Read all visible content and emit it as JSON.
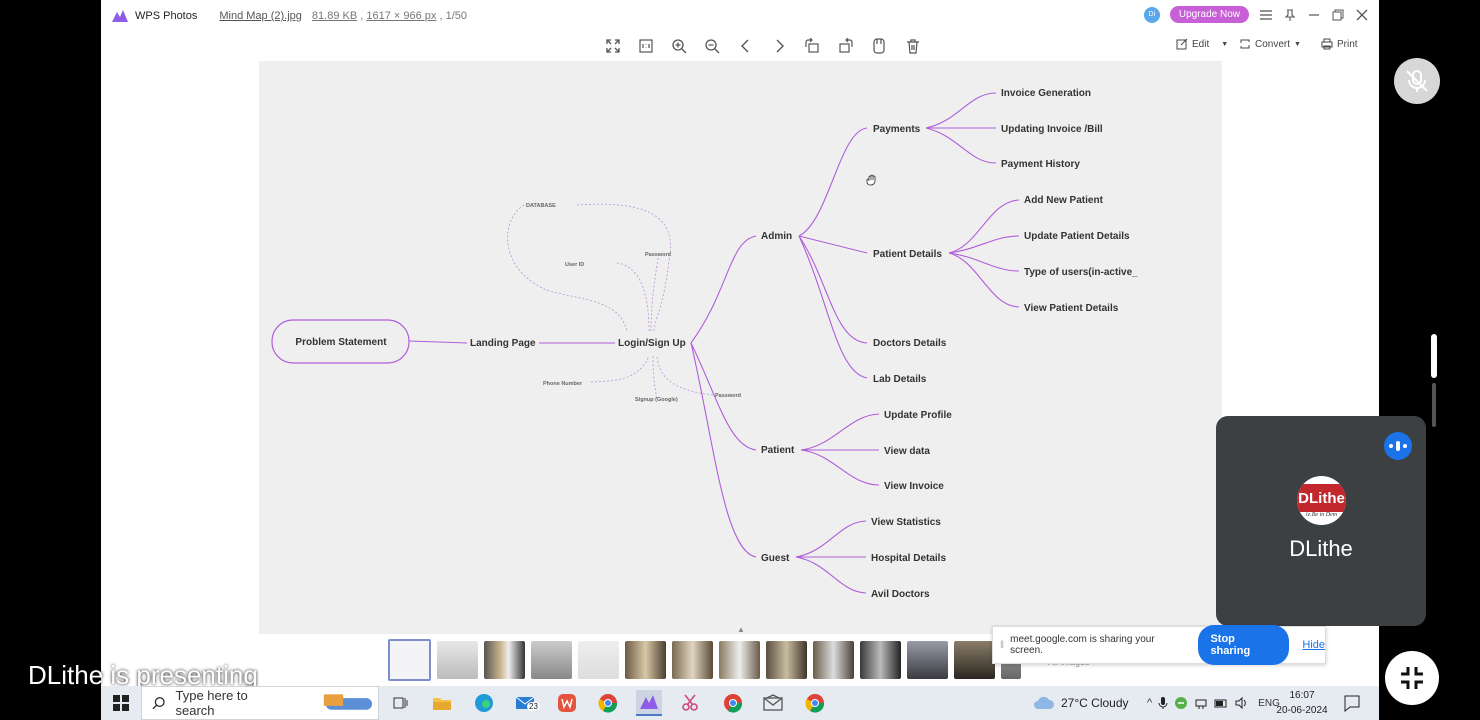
{
  "window": {
    "app_name": "WPS Photos",
    "file_name": "Mind Map (2).jpg",
    "file_size": "81.89 KB",
    "dimensions": "1617 × 966 px",
    "position": ", 1/50",
    "upgrade_label": "Upgrade Now",
    "user_initials": "Di"
  },
  "toolbar": {
    "icons": [
      "fullscreen-icon",
      "actual-size-icon",
      "zoom-in-icon",
      "zoom-out-icon",
      "previous-icon",
      "next-icon",
      "rotate-left-icon",
      "rotate-right-icon",
      "scan-icon",
      "delete-icon"
    ],
    "edit_label": "Edit",
    "convert_label": "Convert",
    "print_label": "Print"
  },
  "mindmap": {
    "root": "Problem Statement",
    "landing": "Landing Page",
    "login": "Login/Sign Up",
    "login_notes": {
      "database": "DATABASE",
      "user_id": "User ID",
      "password_top": "Password",
      "phone": "Phone Number",
      "signup_google": "Signup (Google)",
      "password_bottom": "Password"
    },
    "admin": "Admin",
    "payments": "Payments",
    "payments_children": [
      "Invoice Generation",
      "Updating Invoice /Bill",
      "Payment History"
    ],
    "patient_details": "Patient Details",
    "patient_details_children": [
      "Add New Patient",
      "Update Patient Details",
      "Type of users(in-active_",
      "View Patient Details"
    ],
    "doctors_details": "Doctors Details",
    "lab_details": "Lab Details",
    "patient": "Patient",
    "patient_children": [
      "Update Profile",
      "View data",
      "View Invoice"
    ],
    "guest": "Guest",
    "guest_children": [
      "View Statistics",
      "Hospital Details",
      "Avil Doctors"
    ]
  },
  "meet": {
    "tile_name": "DLithe",
    "avatar_text": "DLithe",
    "avatar_sub": "le.Be in Dem",
    "share_text": "meet.google.com is sharing your screen.",
    "stop_label": "Stop sharing",
    "hide_label": "Hide",
    "presenting": "DLithe is presenting",
    "ghost_text": "All images"
  },
  "taskbar": {
    "search_placeholder": "Type here to search",
    "mail_badge": "23",
    "weather": "27°C  Cloudy",
    "lang": "ENG",
    "time": "16:07",
    "date": "20-06-2024"
  },
  "colors": {
    "mindmap_line": "#b05ed9",
    "upgrade": "#c75fd6",
    "meet_blue": "#1a73e8"
  }
}
